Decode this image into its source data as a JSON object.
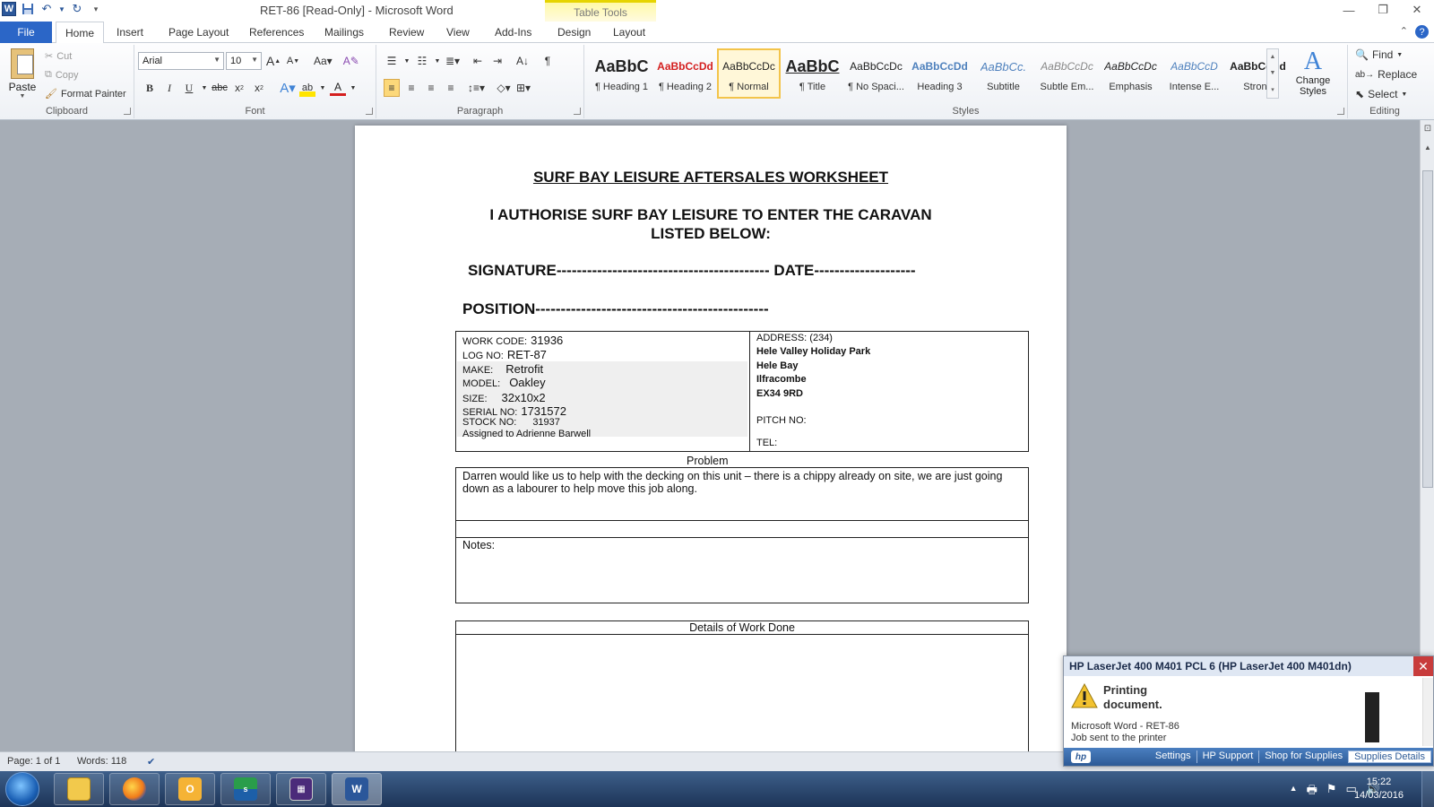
{
  "window": {
    "title": "RET-86 [Read-Only]  -  Microsoft Word",
    "context_tab_header": "Table Tools"
  },
  "tabs": [
    {
      "label": "File"
    },
    {
      "label": "Home"
    },
    {
      "label": "Insert"
    },
    {
      "label": "Page Layout"
    },
    {
      "label": "References"
    },
    {
      "label": "Mailings"
    },
    {
      "label": "Review"
    },
    {
      "label": "View"
    },
    {
      "label": "Add-Ins"
    },
    {
      "label": "Design"
    },
    {
      "label": "Layout"
    }
  ],
  "clipboard": {
    "paste": "Paste",
    "cut": "Cut",
    "copy": "Copy",
    "format_painter": "Format Painter",
    "label": "Clipboard"
  },
  "font": {
    "name": "Arial",
    "size": "10",
    "label": "Font"
  },
  "paragraph": {
    "label": "Paragraph"
  },
  "styles": {
    "label": "Styles",
    "items": [
      {
        "sample": "AaBbC",
        "name": "¶ Heading 1"
      },
      {
        "sample": "AaBbCcDd",
        "name": "¶ Heading 2"
      },
      {
        "sample": "AaBbCcDc",
        "name": "¶ Normal"
      },
      {
        "sample": "AaBbC",
        "name": "¶ Title"
      },
      {
        "sample": "AaBbCcDc",
        "name": "¶ No Spaci..."
      },
      {
        "sample": "AaBbCcDd",
        "name": "Heading 3"
      },
      {
        "sample": "AaBbCc.",
        "name": "Subtitle"
      },
      {
        "sample": "AaBbCcDc",
        "name": "Subtle Em..."
      },
      {
        "sample": "AaBbCcDc",
        "name": "Emphasis"
      },
      {
        "sample": "AaBbCcD",
        "name": "Intense E..."
      },
      {
        "sample": "AaBbCcDd",
        "name": "Strong"
      }
    ],
    "change_styles": "Change Styles"
  },
  "editing": {
    "label": "Editing",
    "find": "Find",
    "replace": "Replace",
    "select": "Select"
  },
  "document": {
    "title1": "SURF BAY LEISURE AFTERSALES WORKSHEET",
    "title2": "I AUTHORISE SURF BAY LEISURE TO ENTER THE CARAVAN",
    "title3": "LISTED BELOW:",
    "signature_line": "SIGNATURE------------------------------------------ DATE--------------------",
    "position_line": "POSITION----------------------------------------------",
    "work_code_label": "WORK CODE:",
    "work_code": "31936",
    "log_no_label": "LOG NO:",
    "log_no": "RET-87",
    "make_label": "MAKE:",
    "make": "Retrofit",
    "model_label": "MODEL:",
    "model": "Oakley",
    "size_label": "SIZE:",
    "size": "32x10x2",
    "serial_label": "SERIAL  NO:",
    "serial": "1731572",
    "stock_label": "STOCK NO:",
    "stock": "31937",
    "assigned": "Assigned to Adrienne Barwell",
    "address_label": "ADDRESS:  (234)",
    "address_lines": [
      "Hele Valley  Holiday Park",
      "Hele Bay",
      "Ilfracombe",
      "EX34  9RD"
    ],
    "pitch_label": "PITCH NO:",
    "tel_label": "TEL:",
    "problem_label": "Problem",
    "problem_text": "Darren would like us to help with the decking on this unit – there is a chippy already on site, we are just going down as a labourer to help move this job along.",
    "notes_label": "Notes:",
    "details_label": "Details of Work Done"
  },
  "status": {
    "page": "Page: 1 of 1",
    "words": "Words: 118"
  },
  "printer_popup": {
    "title": "HP LaserJet 400 M401 PCL 6 (HP LaserJet 400 M401dn)",
    "main_line1": "Printing",
    "main_line2": "document.",
    "sub_line1": "Microsoft Word - RET-86",
    "sub_line2": "Job sent to the printer",
    "links": [
      "Settings",
      "HP Support",
      "Shop for Supplies",
      "Supplies Details"
    ]
  },
  "taskbar": {
    "time": "15:22",
    "date": "14/03/2016",
    "apps": [
      "explorer",
      "firefox",
      "outlook",
      "sage",
      "calculator",
      "word"
    ]
  }
}
